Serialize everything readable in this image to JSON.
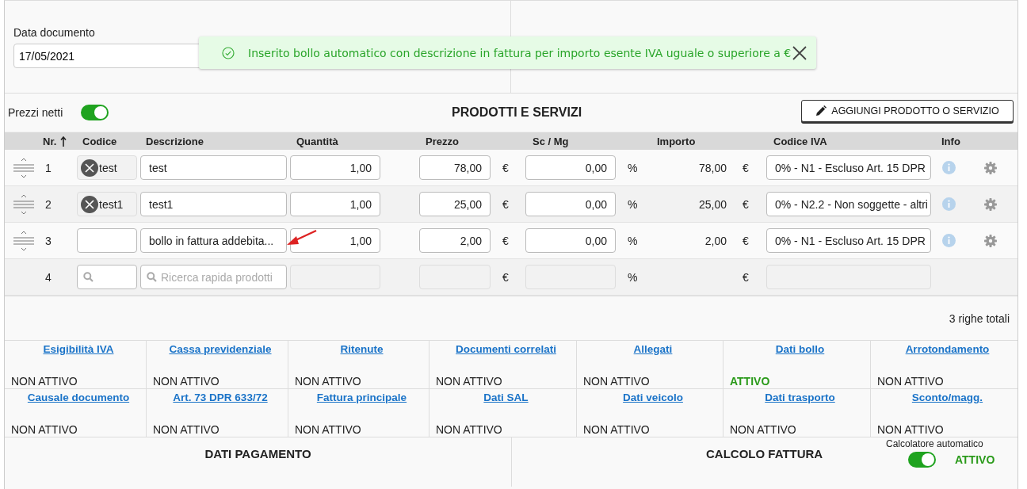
{
  "date_field": {
    "label": "Data documento",
    "value": "17/05/2021"
  },
  "notification": {
    "message": "Inserito bollo automatico con descrizione in fattura per importo esente IVA uguale o superiore a €"
  },
  "net_prices": {
    "label": "Prezzi netti",
    "on": true
  },
  "section_title": "PRODOTTI E SERVIZI",
  "add_button": "AGGIUNGI PRODOTTO O SERVIZIO",
  "table": {
    "columns": [
      {
        "label": "Nr.",
        "sorted": true
      },
      {
        "label": "Codice",
        "sorted": false
      },
      {
        "label": "Descrizione",
        "sorted": false
      },
      {
        "label": "Quantità",
        "sorted": false
      },
      {
        "label": "Prezzo",
        "sorted": false
      },
      {
        "label": "Sc / Mg",
        "sorted": false
      },
      {
        "label": "Importo",
        "sorted": false
      },
      {
        "label": "Codice IVA",
        "sorted": false
      },
      {
        "label": "Info",
        "sorted": false
      }
    ],
    "rows": [
      {
        "kind": "item",
        "number": "1",
        "code": "test",
        "description": "test",
        "quantity": "1,00",
        "price": "78,00",
        "currency": "€",
        "discount": "0,00",
        "percent": "%",
        "amount": "78,00",
        "amount_currency": "€",
        "vat_code": "0% - N1 - Escluso Art. 15 DPR",
        "marked": false
      },
      {
        "kind": "item",
        "number": "2",
        "code": "test1",
        "description": "test1",
        "quantity": "1,00",
        "price": "25,00",
        "currency": "€",
        "discount": "0,00",
        "percent": "%",
        "amount": "25,00",
        "amount_currency": "€",
        "vat_code": "0% - N2.2 - Non soggette - altri",
        "marked": false
      },
      {
        "kind": "item",
        "number": "3",
        "description": "bollo in fattura addebita...",
        "quantity": "1,00",
        "price": "2,00",
        "currency": "€",
        "discount": "0,00",
        "percent": "%",
        "amount": "2,00",
        "amount_currency": "€",
        "vat_code": "0% - N1 - Escluso Art. 15 DPR",
        "marked": true
      },
      {
        "kind": "new",
        "number": "4",
        "description_placeholder": "Ricerca rapida prodotti",
        "currency": "€",
        "percent": "%",
        "amount_currency": "€",
        "marked": false
      }
    ],
    "total_rows": "3 righe totali"
  },
  "options": [
    {
      "title": "Esigibilità IVA",
      "status": "NON ATTIVO",
      "active": false
    },
    {
      "title": "Cassa previdenziale",
      "status": "NON ATTIVO",
      "active": false
    },
    {
      "title": "Ritenute",
      "status": "NON ATTIVO",
      "active": false
    },
    {
      "title": "Documenti correlati",
      "status": "NON ATTIVO",
      "active": false
    },
    {
      "title": "Allegati",
      "status": "NON ATTIVO",
      "active": false
    },
    {
      "title": "Dati bollo",
      "status": "ATTIVO",
      "active": true
    },
    {
      "title": "Arrotondamento",
      "status": "NON ATTIVO",
      "active": false
    },
    {
      "title": "Causale documento",
      "status": "NON ATTIVO",
      "active": false
    },
    {
      "title": "Art. 73 DPR 633/72",
      "status": "NON ATTIVO",
      "active": false
    },
    {
      "title": "Fattura principale",
      "status": "NON ATTIVO",
      "active": false
    },
    {
      "title": "Dati SAL",
      "status": "NON ATTIVO",
      "active": false
    },
    {
      "title": "Dati veicolo",
      "status": "NON ATTIVO",
      "active": false
    },
    {
      "title": "Dati trasporto",
      "status": "NON ATTIVO",
      "active": false
    },
    {
      "title": "Sconto/magg.",
      "status": "NON ATTIVO",
      "active": false
    }
  ],
  "payment_title": "DATI PAGAMENTO",
  "invoice_calc": {
    "title": "CALCOLO FATTURA",
    "auto_label": "Calcolatore automatico",
    "on": true,
    "status": "ATTIVO"
  }
}
